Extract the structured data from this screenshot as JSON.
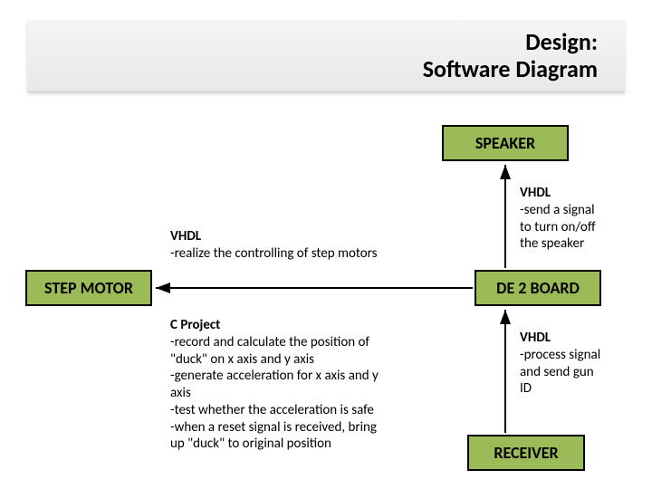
{
  "title": {
    "line1": "Design:",
    "line2": "Software Diagram"
  },
  "nodes": {
    "speaker": "SPEAKER",
    "step_motor": "STEP MOTOR",
    "de2_board": "DE 2 BOARD",
    "receiver": "RECEIVER"
  },
  "labels": {
    "vhdl_step": {
      "hd": "VHDL",
      "body": "-realize the controlling of step motors"
    },
    "vhdl_speaker": {
      "hd": "VHDL",
      "l1": "-send a signal",
      "l2": "to turn on/off",
      "l3": "the speaker"
    },
    "c_project": {
      "hd": "C Project",
      "l1": "-record and calculate the position of",
      "l2": "\"duck\" on x axis and y axis",
      "l3": "-generate acceleration for x axis and y",
      "l4": "axis",
      "l5": "-test whether the acceleration is safe",
      "l6": "-when a reset signal is received, bring",
      "l7": "up \"duck\" to original position"
    },
    "vhdl_receiver": {
      "hd": "VHDL",
      "l1": "-process signal",
      "l2": "and send gun",
      "l3": "ID"
    }
  }
}
